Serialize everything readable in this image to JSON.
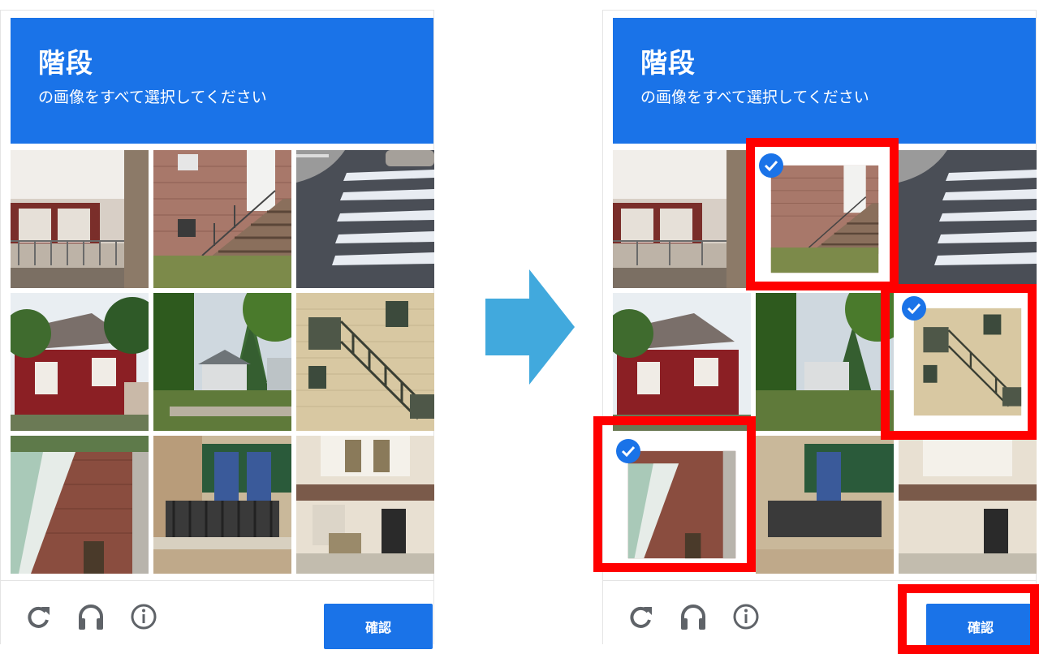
{
  "captcha": {
    "title": "階段",
    "subtitle": "の画像をすべて選択してください",
    "confirm_label": "確認",
    "header_color": "#1a73e8",
    "tiles": [
      {
        "icon": "house-balcony-image",
        "selected_after": false
      },
      {
        "icon": "brick-stairs-image",
        "selected_after": true
      },
      {
        "icon": "crosswalk-image",
        "selected_after": false
      },
      {
        "icon": "red-house-image",
        "selected_after": false
      },
      {
        "icon": "trees-house-image",
        "selected_after": false
      },
      {
        "icon": "outdoor-staircase-image",
        "selected_after": true
      },
      {
        "icon": "brick-wall-stairs-image",
        "selected_after": true
      },
      {
        "icon": "balcony-building-image",
        "selected_after": false
      },
      {
        "icon": "storefront-image",
        "selected_after": false
      }
    ],
    "footer_icons": [
      "reload-icon",
      "headphones-icon",
      "info-icon"
    ]
  },
  "highlight_color": "#ff0000",
  "arrow_color": "#41a9dd"
}
